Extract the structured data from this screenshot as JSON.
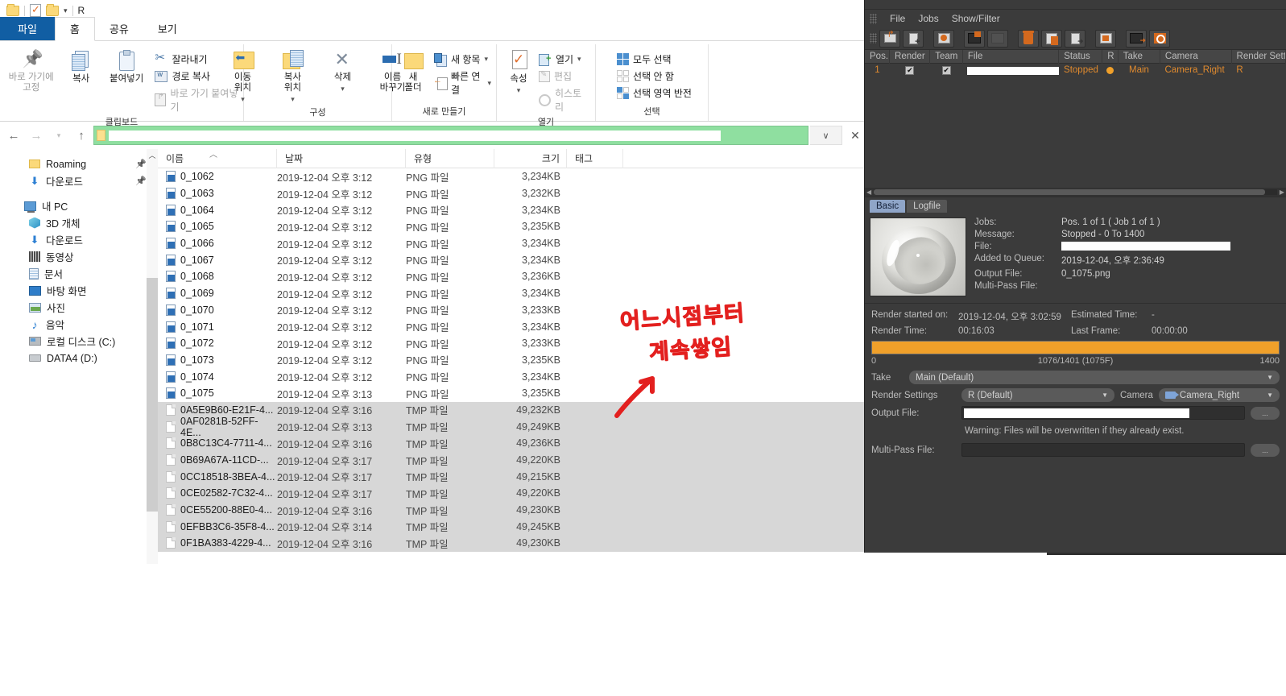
{
  "explorer": {
    "titlebar": {
      "app_label": "R"
    },
    "tabs": [
      {
        "label": "파일",
        "kind": "file"
      },
      {
        "label": "홈",
        "kind": "active"
      },
      {
        "label": "공유",
        "kind": "normal"
      },
      {
        "label": "보기",
        "kind": "normal"
      }
    ],
    "ribbon": {
      "clipboard": {
        "group_label": "클립보드",
        "pin": "바로 가기에\n고정",
        "copy": "복사",
        "paste": "붙여넣기",
        "cut": "잘라내기",
        "copy_path": "경로 복사",
        "paste_shortcut": "바로 가기 붙여넣기"
      },
      "organize": {
        "group_label": "구성",
        "move_to": "이동\n위치",
        "copy_to": "복사\n위치",
        "delete": "삭제",
        "rename": "이름\n바꾸기"
      },
      "new": {
        "group_label": "새로 만들기",
        "new_folder": "새\n폴더",
        "new_item": "새 항목",
        "quick_access": "빠른 연결"
      },
      "open": {
        "group_label": "열기",
        "properties": "속성",
        "open": "열기",
        "edit": "편집",
        "history": "히스토리"
      },
      "select": {
        "group_label": "선택",
        "select_all": "모두 선택",
        "select_none": "선택 안 함",
        "invert": "선택 영역 반전"
      }
    },
    "navpane": {
      "items": [
        {
          "label": "Roaming",
          "icon": "folder-icon",
          "indent": 1,
          "pinned": true
        },
        {
          "label": "다운로드",
          "icon": "download-icon",
          "indent": 1,
          "pinned": true
        },
        {
          "label": "내 PC",
          "icon": "pc-icon",
          "indent": 0,
          "pinned": false
        },
        {
          "label": "3D 개체",
          "icon": "3d-objects-icon",
          "indent": 1,
          "pinned": false
        },
        {
          "label": "다운로드",
          "icon": "download-icon",
          "indent": 1,
          "pinned": false
        },
        {
          "label": "동영상",
          "icon": "videos-icon",
          "indent": 1,
          "pinned": false
        },
        {
          "label": "문서",
          "icon": "documents-icon",
          "indent": 1,
          "pinned": false
        },
        {
          "label": "바탕 화면",
          "icon": "desktop-icon",
          "indent": 1,
          "pinned": false
        },
        {
          "label": "사진",
          "icon": "pictures-icon",
          "indent": 1,
          "pinned": false
        },
        {
          "label": "음악",
          "icon": "music-icon",
          "indent": 1,
          "pinned": false
        },
        {
          "label": "로컬 디스크 (C:)",
          "icon": "disk-icon",
          "indent": 1,
          "pinned": false
        },
        {
          "label": "DATA4 (D:)",
          "icon": "drive-icon",
          "indent": 1,
          "pinned": false
        }
      ]
    },
    "filelist": {
      "columns": [
        "이름",
        "날짜",
        "유형",
        "크기",
        "태그"
      ],
      "rows": [
        {
          "name": "0_1062",
          "date": "2019-12-04 오후 3:12",
          "type": "PNG 파일",
          "size": "3,234KB",
          "icon": "png-file-icon",
          "selected": false
        },
        {
          "name": "0_1063",
          "date": "2019-12-04 오후 3:12",
          "type": "PNG 파일",
          "size": "3,232KB",
          "icon": "png-file-icon",
          "selected": false
        },
        {
          "name": "0_1064",
          "date": "2019-12-04 오후 3:12",
          "type": "PNG 파일",
          "size": "3,234KB",
          "icon": "png-file-icon",
          "selected": false
        },
        {
          "name": "0_1065",
          "date": "2019-12-04 오후 3:12",
          "type": "PNG 파일",
          "size": "3,235KB",
          "icon": "png-file-icon",
          "selected": false
        },
        {
          "name": "0_1066",
          "date": "2019-12-04 오후 3:12",
          "type": "PNG 파일",
          "size": "3,234KB",
          "icon": "png-file-icon",
          "selected": false
        },
        {
          "name": "0_1067",
          "date": "2019-12-04 오후 3:12",
          "type": "PNG 파일",
          "size": "3,234KB",
          "icon": "png-file-icon",
          "selected": false
        },
        {
          "name": "0_1068",
          "date": "2019-12-04 오후 3:12",
          "type": "PNG 파일",
          "size": "3,236KB",
          "icon": "png-file-icon",
          "selected": false
        },
        {
          "name": "0_1069",
          "date": "2019-12-04 오후 3:12",
          "type": "PNG 파일",
          "size": "3,234KB",
          "icon": "png-file-icon",
          "selected": false
        },
        {
          "name": "0_1070",
          "date": "2019-12-04 오후 3:12",
          "type": "PNG 파일",
          "size": "3,233KB",
          "icon": "png-file-icon",
          "selected": false
        },
        {
          "name": "0_1071",
          "date": "2019-12-04 오후 3:12",
          "type": "PNG 파일",
          "size": "3,234KB",
          "icon": "png-file-icon",
          "selected": false
        },
        {
          "name": "0_1072",
          "date": "2019-12-04 오후 3:12",
          "type": "PNG 파일",
          "size": "3,233KB",
          "icon": "png-file-icon",
          "selected": false
        },
        {
          "name": "0_1073",
          "date": "2019-12-04 오후 3:12",
          "type": "PNG 파일",
          "size": "3,235KB",
          "icon": "png-file-icon",
          "selected": false
        },
        {
          "name": "0_1074",
          "date": "2019-12-04 오후 3:12",
          "type": "PNG 파일",
          "size": "3,234KB",
          "icon": "png-file-icon",
          "selected": false
        },
        {
          "name": "0_1075",
          "date": "2019-12-04 오후 3:13",
          "type": "PNG 파일",
          "size": "3,235KB",
          "icon": "png-file-icon",
          "selected": false
        },
        {
          "name": "0A5E9B60-E21F-4...",
          "date": "2019-12-04 오후 3:16",
          "type": "TMP 파일",
          "size": "49,232KB",
          "icon": "tmp-file-icon",
          "selected": true
        },
        {
          "name": "0AF0281B-52FF-4E...",
          "date": "2019-12-04 오후 3:13",
          "type": "TMP 파일",
          "size": "49,249KB",
          "icon": "tmp-file-icon",
          "selected": true
        },
        {
          "name": "0B8C13C4-7711-4...",
          "date": "2019-12-04 오후 3:16",
          "type": "TMP 파일",
          "size": "49,236KB",
          "icon": "tmp-file-icon",
          "selected": true
        },
        {
          "name": "0B69A67A-11CD-...",
          "date": "2019-12-04 오후 3:17",
          "type": "TMP 파일",
          "size": "49,220KB",
          "icon": "tmp-file-icon",
          "selected": true
        },
        {
          "name": "0CC18518-3BEA-4...",
          "date": "2019-12-04 오후 3:17",
          "type": "TMP 파일",
          "size": "49,215KB",
          "icon": "tmp-file-icon",
          "selected": true
        },
        {
          "name": "0CE02582-7C32-4...",
          "date": "2019-12-04 오후 3:17",
          "type": "TMP 파일",
          "size": "49,220KB",
          "icon": "tmp-file-icon",
          "selected": true
        },
        {
          "name": "0CE55200-88E0-4...",
          "date": "2019-12-04 오후 3:16",
          "type": "TMP 파일",
          "size": "49,230KB",
          "icon": "tmp-file-icon",
          "selected": true
        },
        {
          "name": "0EFBB3C6-35F8-4...",
          "date": "2019-12-04 오후 3:14",
          "type": "TMP 파일",
          "size": "49,245KB",
          "icon": "tmp-file-icon",
          "selected": true
        },
        {
          "name": "0F1BA383-4229-4...",
          "date": "2019-12-04 오후 3:16",
          "type": "TMP 파일",
          "size": "49,230KB",
          "icon": "tmp-file-icon",
          "selected": true
        }
      ]
    },
    "annotation": {
      "line1": "어느시점부터",
      "line2": "계속쌓임",
      "color": "#e3201f"
    }
  },
  "c4d": {
    "menu": [
      "File",
      "Jobs",
      "Show/Filter"
    ],
    "toolbar_icons": [
      "open-folder-icon",
      "add-job-icon",
      "render-web-icon",
      "render-movie-icon",
      "clapperboard-disabled-icon",
      "delete-icon",
      "delete-list-icon",
      "export-icon",
      "screen-icon",
      "render-to-picture-icon",
      "preview-search-icon"
    ],
    "job_columns": [
      "Pos.",
      "Render",
      "Team",
      "File",
      "Status",
      "R",
      "Take",
      "Camera",
      "Render Setti"
    ],
    "job_row": {
      "pos": "1",
      "render_checked": "✔",
      "team_checked": "✔",
      "file": "",
      "status": "Stopped",
      "r": "",
      "take": "Main",
      "camera": "Camera_Right",
      "render_settings": "R"
    },
    "tabs": [
      {
        "label": "Basic",
        "active": true
      },
      {
        "label": "Logfile",
        "active": false
      }
    ],
    "details": {
      "jobs_label": "Jobs:",
      "jobs_value": "Pos. 1 of 1 ( Job 1 of 1 )",
      "message_label": "Message:",
      "message_value": "Stopped - 0 To 1400",
      "file_label": "File:",
      "file_value": "",
      "added_label": "Added to Queue:",
      "added_value": "2019-12-04, 오후 2:36:49",
      "output_label": "Output File:",
      "output_value": "0_1075.png",
      "multipass_label": "Multi-Pass File:",
      "multipass_value": ""
    },
    "times": {
      "render_started_label": "Render started on:",
      "render_started_value": "2019-12-04, 오후 3:02:59",
      "estimated_label": "Estimated Time:",
      "estimated_value": "-",
      "render_time_label": "Render Time:",
      "render_time_value": "00:16:03",
      "last_frame_label": "Last Frame:",
      "last_frame_value": "00:00:00"
    },
    "progress": {
      "start": "0",
      "current": "1076/1401 (1075F)",
      "end": "1400",
      "percent": 100,
      "color": "#f0a02a"
    },
    "fields": {
      "take_label": "Take",
      "take_value": "Main (Default)",
      "render_settings_label": "Render Settings",
      "render_settings_value": "R (Default)",
      "camera_label": "Camera",
      "camera_value": "Camera_Right",
      "output_file_label": "Output File:",
      "output_file_value": "",
      "output_browse": "...",
      "warning": "Warning: Files will be overwritten if they already exist.",
      "multipass_label": "Multi-Pass File:",
      "multipass_value": "",
      "multipass_browse": "..."
    }
  }
}
